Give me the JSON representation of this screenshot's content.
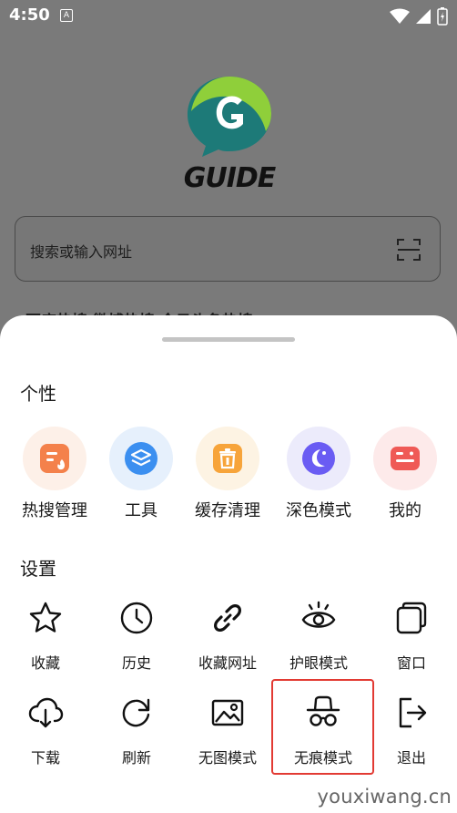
{
  "status": {
    "time": "4:50",
    "notif": "A"
  },
  "browser": {
    "logo_text": "GUIDE",
    "search_placeholder": "搜索或输入网址",
    "hot_tabs": "百度热搜   微博热搜   今日头条热搜"
  },
  "sheet": {
    "section_personal": "个性",
    "personal_items": [
      {
        "label": "热搜管理",
        "icon": "hot-search-icon",
        "color": "#f4814b",
        "bg": "#fdf0e8"
      },
      {
        "label": "工具",
        "icon": "tools-icon",
        "color": "#3b8ff0",
        "bg": "#e6f0fc"
      },
      {
        "label": "缓存清理",
        "icon": "trash-icon",
        "color": "#f7a43a",
        "bg": "#fdf3e3"
      },
      {
        "label": "深色模式",
        "icon": "dark-mode-icon",
        "color": "#6a5cf3",
        "bg": "#ecebfb"
      },
      {
        "label": "我的",
        "icon": "mine-icon",
        "color": "#ef5a56",
        "bg": "#fdeaea"
      }
    ],
    "section_settings": "设置",
    "settings_row1": [
      {
        "label": "收藏",
        "icon": "star-icon"
      },
      {
        "label": "历史",
        "icon": "clock-icon"
      },
      {
        "label": "收藏网址",
        "icon": "link-icon"
      },
      {
        "label": "护眼模式",
        "icon": "eye-icon"
      },
      {
        "label": "窗口",
        "icon": "window-icon"
      }
    ],
    "settings_row2": [
      {
        "label": "下载",
        "icon": "cloud-download-icon"
      },
      {
        "label": "刷新",
        "icon": "refresh-icon"
      },
      {
        "label": "无图模式",
        "icon": "image-icon"
      },
      {
        "label": "无痕模式",
        "icon": "incognito-icon"
      },
      {
        "label": "退出",
        "icon": "exit-icon"
      }
    ]
  },
  "watermark": "youxiwang.cn"
}
